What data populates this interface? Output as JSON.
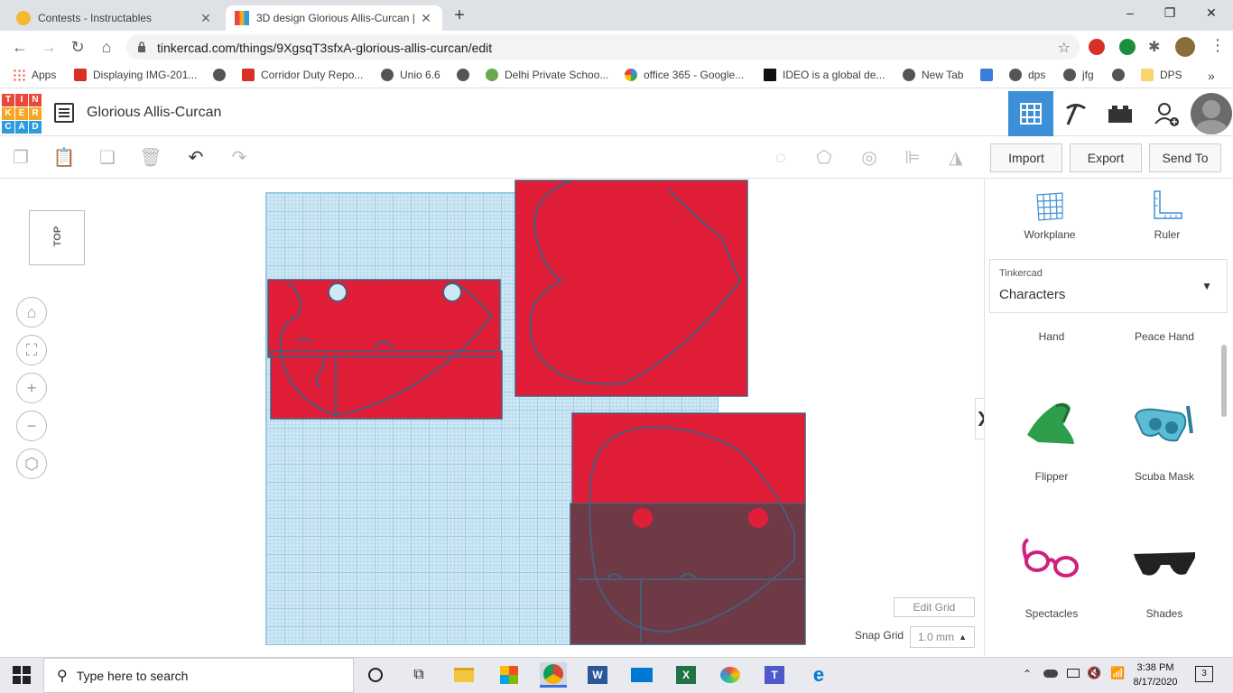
{
  "browser": {
    "tabs": [
      {
        "title": "Contests - Instructables",
        "active": false
      },
      {
        "title": "3D design Glorious Allis-Curcan |",
        "active": true
      }
    ],
    "url": "tinkercad.com/things/9XgsqT3sfxA-glorious-allis-curcan/edit",
    "bookmarks": [
      "Apps",
      "Displaying IMG-201...",
      "Corridor Duty Repo...",
      "Unio 6.6",
      "Delhi Private Schoo...",
      "office 365 - Google...",
      "IDEO is a global de...",
      "New Tab",
      "dps",
      "jfg",
      "DPS"
    ],
    "bookmarks_more": "»"
  },
  "tinkercad": {
    "logo_letters": [
      "T",
      "I",
      "N",
      "K",
      "E",
      "R",
      "C",
      "A",
      "D"
    ],
    "logo_colors": [
      "#e8493a",
      "#e8493a",
      "#e8493a",
      "#f5a623",
      "#f5a623",
      "#f5a623",
      "#2d9cdb",
      "#2d9cdb",
      "#2d9cdb"
    ],
    "design_title": "Glorious Allis-Curcan",
    "buttons": {
      "import": "Import",
      "export": "Export",
      "send_to": "Send To"
    },
    "viewcube_label": "TOP",
    "edit_grid": "Edit Grid",
    "snap_grid_label": "Snap Grid",
    "snap_grid_value": "1.0 mm",
    "panel": {
      "workplane": "Workplane",
      "ruler": "Ruler",
      "library_source": "Tinkercad",
      "library_name": "Characters",
      "shapes": [
        "Hand",
        "Peace Hand",
        "Flipper",
        "Scuba Mask",
        "Spectacles",
        "Shades"
      ]
    },
    "colors": {
      "shape_red": "#e01e37",
      "hole_gray": "#6e3a45",
      "grid_blue": "#cfe8f5",
      "active_tool": "#3d8fd7"
    }
  },
  "taskbar": {
    "search_placeholder": "Type here to search",
    "time": "3:38 PM",
    "date": "8/17/2020",
    "notifications": "3"
  }
}
